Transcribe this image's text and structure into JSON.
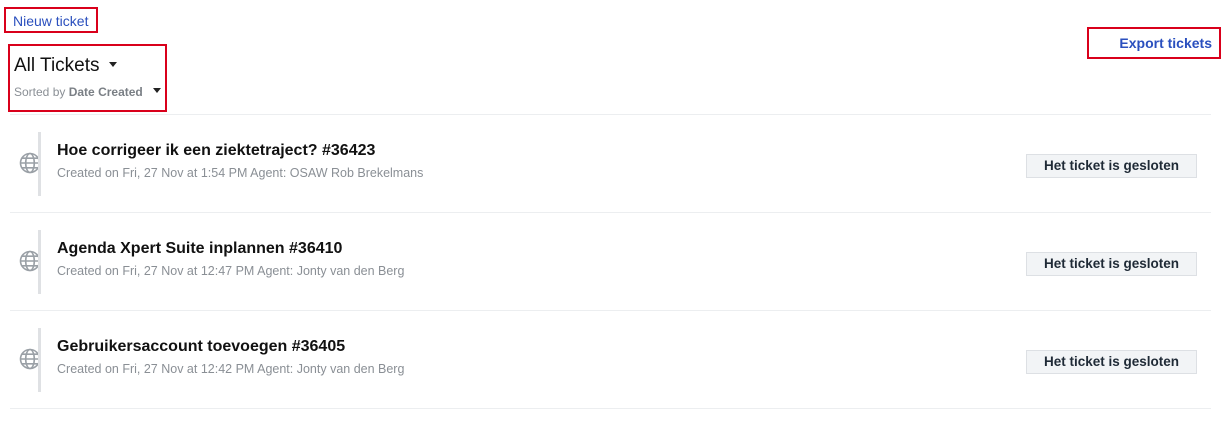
{
  "header": {
    "new_ticket_label": "Nieuw ticket",
    "export_label": "Export tickets"
  },
  "filter": {
    "view_label": "All Tickets",
    "sort_prefix": "Sorted by",
    "sort_field": "Date Created"
  },
  "tickets": [
    {
      "subject": "Hoe corrigeer ik een ziektetraject? #36423",
      "meta": "Created on Fri, 27 Nov at 1:54 PM Agent: OSAW Rob Brekelmans",
      "status": "Het ticket is gesloten"
    },
    {
      "subject": "Agenda Xpert Suite inplannen #36410",
      "meta": "Created on Fri, 27 Nov at 12:47 PM Agent: Jonty van den Berg",
      "status": "Het ticket is gesloten"
    },
    {
      "subject": "Gebruikersaccount toevoegen #36405",
      "meta": "Created on Fri, 27 Nov at 12:42 PM Agent: Jonty van den Berg",
      "status": "Het ticket is gesloten"
    }
  ],
  "icons": {
    "ticket_source": "globe-icon",
    "dropdown": "caret-down-icon"
  },
  "colors": {
    "link": "#2a4fbe",
    "highlight_border": "#d9001b",
    "muted_text": "#8a8f95",
    "status_bg": "#f2f4f6"
  }
}
